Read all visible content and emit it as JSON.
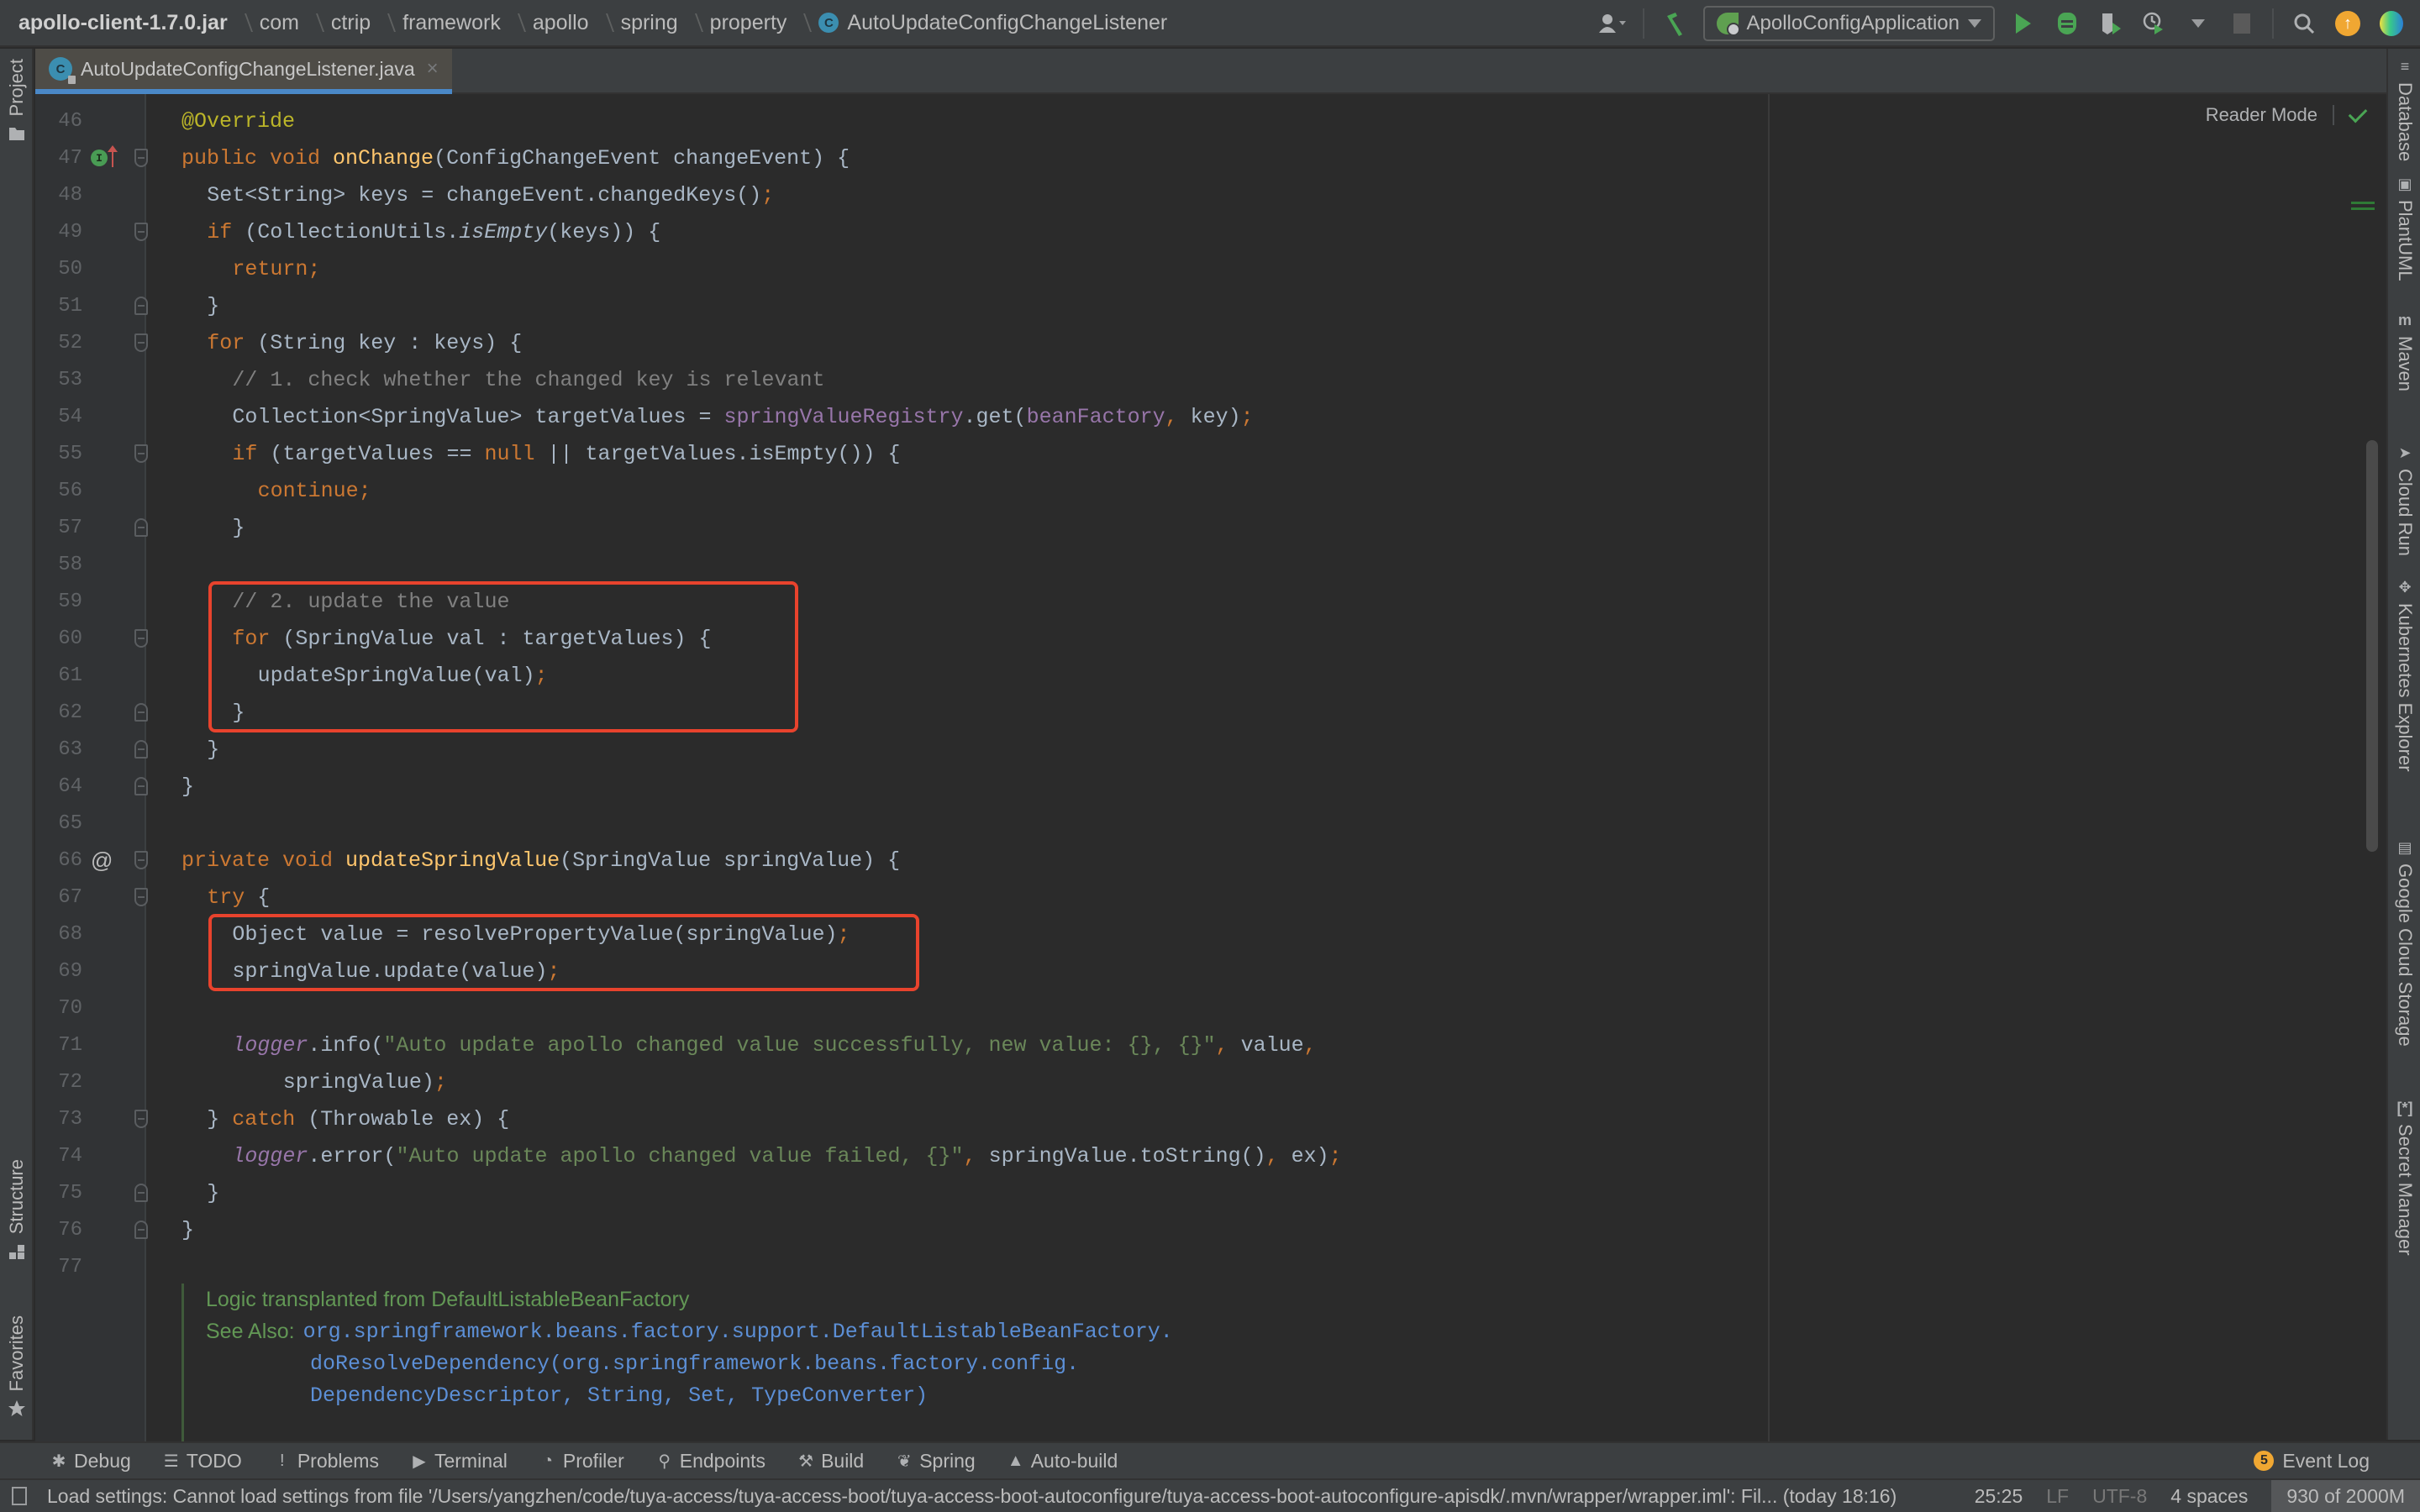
{
  "breadcrumbs": [
    {
      "label": "apollo-client-1.7.0.jar"
    },
    {
      "label": "com"
    },
    {
      "label": "ctrip"
    },
    {
      "label": "framework"
    },
    {
      "label": "apollo"
    },
    {
      "label": "spring"
    },
    {
      "label": "property"
    },
    {
      "label": "AutoUpdateConfigChangeListener",
      "icon": "class-icon"
    }
  ],
  "toolbar": {
    "run_config": "ApolloConfigApplication",
    "icons": [
      "user-icon",
      "build-hammer-icon",
      "run-icon",
      "debug-icon",
      "coverage-icon",
      "profile-icon",
      "stop-icon",
      "search-icon",
      "update-icon",
      "toolbox-icon"
    ],
    "class_icon_letter": "C"
  },
  "tab": {
    "label": "AutoUpdateConfigChangeListener.java",
    "close": "×"
  },
  "left_strip": {
    "top": [
      {
        "label": "Project"
      }
    ],
    "bottom": [
      {
        "label": "Structure"
      },
      {
        "label": "Favorites"
      }
    ]
  },
  "right_strip": [
    {
      "label": "Database",
      "icon": "database-icon",
      "glyph": "≡"
    },
    {
      "label": "PlantUML",
      "icon": "plantuml-icon",
      "glyph": "▣"
    },
    {
      "label": "Maven",
      "icon": "maven-icon",
      "glyph": "m"
    },
    {
      "label": "Cloud Run",
      "icon": "cloud-run-icon",
      "glyph": "➤"
    },
    {
      "label": "Kubernetes Explorer",
      "icon": "kubernetes-icon",
      "glyph": "✥"
    },
    {
      "label": "Google Cloud Storage",
      "icon": "cloud-storage-icon",
      "glyph": "▤"
    },
    {
      "label": "Secret Manager",
      "icon": "secret-manager-icon",
      "glyph": "[*]"
    }
  ],
  "editor": {
    "reader_mode": "Reader Mode",
    "lines": [
      {
        "n": "46",
        "tokens": [
          {
            "t": "@Override",
            "c": "ann"
          }
        ],
        "indent": 1
      },
      {
        "n": "47",
        "tokens": [
          {
            "t": "public void ",
            "c": "kw"
          },
          {
            "t": "onChange",
            "c": "fn"
          },
          {
            "t": "(ConfigChangeEvent changeEvent) {",
            "c": ""
          }
        ],
        "indent": 1,
        "marker": "implements",
        "fold": "open"
      },
      {
        "n": "48",
        "tokens": [
          {
            "t": "Set<String> keys = changeEvent.changedKeys()",
            "c": ""
          },
          {
            "t": ";",
            "c": "kw"
          }
        ],
        "indent": 2
      },
      {
        "n": "49",
        "tokens": [
          {
            "t": "if ",
            "c": "kw"
          },
          {
            "t": "(CollectionUtils.",
            "c": ""
          },
          {
            "t": "isEmpty",
            "c": "it"
          },
          {
            "t": "(keys)) {",
            "c": ""
          }
        ],
        "indent": 2,
        "fold": "open"
      },
      {
        "n": "50",
        "tokens": [
          {
            "t": "return;",
            "c": "kw"
          }
        ],
        "indent": 3
      },
      {
        "n": "51",
        "tokens": [
          {
            "t": "}",
            "c": ""
          }
        ],
        "indent": 2,
        "fold": "close"
      },
      {
        "n": "52",
        "tokens": [
          {
            "t": "for ",
            "c": "kw"
          },
          {
            "t": "(String key : keys) {",
            "c": ""
          }
        ],
        "indent": 2,
        "fold": "open"
      },
      {
        "n": "53",
        "tokens": [
          {
            "t": "// 1. check whether the changed key is relevant",
            "c": "cm"
          }
        ],
        "indent": 3
      },
      {
        "n": "54",
        "tokens": [
          {
            "t": "Collection<SpringValue> targetValues = ",
            "c": ""
          },
          {
            "t": "springValueRegistry",
            "c": "fld"
          },
          {
            "t": ".get(",
            "c": ""
          },
          {
            "t": "beanFactory",
            "c": "fld"
          },
          {
            "t": ", ",
            "c": "kw"
          },
          {
            "t": "key)",
            "c": ""
          },
          {
            "t": ";",
            "c": "kw"
          }
        ],
        "indent": 3
      },
      {
        "n": "55",
        "tokens": [
          {
            "t": "if ",
            "c": "kw"
          },
          {
            "t": "(targetValues == ",
            "c": ""
          },
          {
            "t": "null ",
            "c": "kw"
          },
          {
            "t": "|| targetValues.isEmpty()) {",
            "c": ""
          }
        ],
        "indent": 3,
        "fold": "open"
      },
      {
        "n": "56",
        "tokens": [
          {
            "t": "continue;",
            "c": "kw"
          }
        ],
        "indent": 4
      },
      {
        "n": "57",
        "tokens": [
          {
            "t": "}",
            "c": ""
          }
        ],
        "indent": 3,
        "fold": "close"
      },
      {
        "n": "58",
        "tokens": [],
        "indent": 3
      },
      {
        "n": "59",
        "tokens": [
          {
            "t": "// 2. update the value",
            "c": "cm"
          }
        ],
        "indent": 3
      },
      {
        "n": "60",
        "tokens": [
          {
            "t": "for ",
            "c": "kw"
          },
          {
            "t": "(SpringValue val : targetValues) {",
            "c": ""
          }
        ],
        "indent": 3,
        "fold": "open"
      },
      {
        "n": "61",
        "tokens": [
          {
            "t": "updateSpringValue(val)",
            "c": ""
          },
          {
            "t": ";",
            "c": "kw"
          }
        ],
        "indent": 4
      },
      {
        "n": "62",
        "tokens": [
          {
            "t": "}",
            "c": ""
          }
        ],
        "indent": 3,
        "fold": "close"
      },
      {
        "n": "63",
        "tokens": [
          {
            "t": "}",
            "c": ""
          }
        ],
        "indent": 2,
        "fold": "close"
      },
      {
        "n": "64",
        "tokens": [
          {
            "t": "}",
            "c": ""
          }
        ],
        "indent": 1,
        "fold": "close"
      },
      {
        "n": "65",
        "tokens": [],
        "indent": 1
      },
      {
        "n": "66",
        "tokens": [
          {
            "t": "private void ",
            "c": "kw"
          },
          {
            "t": "updateSpringValue",
            "c": "fn"
          },
          {
            "t": "(SpringValue springValue) {",
            "c": ""
          }
        ],
        "indent": 1,
        "marker": "at",
        "fold": "open"
      },
      {
        "n": "67",
        "tokens": [
          {
            "t": "try ",
            "c": "kw"
          },
          {
            "t": "{",
            "c": ""
          }
        ],
        "indent": 2,
        "fold": "open"
      },
      {
        "n": "68",
        "tokens": [
          {
            "t": "Object value = resolvePropertyValue(springValue)",
            "c": ""
          },
          {
            "t": ";",
            "c": "kw"
          }
        ],
        "indent": 3
      },
      {
        "n": "69",
        "tokens": [
          {
            "t": "springValue.update(value)",
            "c": ""
          },
          {
            "t": ";",
            "c": "kw"
          }
        ],
        "indent": 3
      },
      {
        "n": "70",
        "tokens": [],
        "indent": 3
      },
      {
        "n": "71",
        "tokens": [
          {
            "t": "logger",
            "c": "fld it"
          },
          {
            "t": ".info(",
            "c": ""
          },
          {
            "t": "\"Auto update apollo changed value successfully, new value: {}, {}\"",
            "c": "str"
          },
          {
            "t": ", ",
            "c": "kw"
          },
          {
            "t": "value",
            "c": ""
          },
          {
            "t": ",",
            "c": "kw"
          }
        ],
        "indent": 3
      },
      {
        "n": "72",
        "tokens": [
          {
            "t": "springValue)",
            "c": ""
          },
          {
            "t": ";",
            "c": "kw"
          }
        ],
        "indent": 5
      },
      {
        "n": "73",
        "tokens": [
          {
            "t": "} ",
            "c": ""
          },
          {
            "t": "catch ",
            "c": "kw"
          },
          {
            "t": "(Throwable ex) {",
            "c": ""
          }
        ],
        "indent": 2,
        "fold": "open"
      },
      {
        "n": "74",
        "tokens": [
          {
            "t": "logger",
            "c": "fld it"
          },
          {
            "t": ".error(",
            "c": ""
          },
          {
            "t": "\"Auto update apollo changed value failed, {}\"",
            "c": "str"
          },
          {
            "t": ", ",
            "c": "kw"
          },
          {
            "t": "springValue.toString()",
            "c": ""
          },
          {
            "t": ", ",
            "c": "kw"
          },
          {
            "t": "ex)",
            "c": ""
          },
          {
            "t": ";",
            "c": "kw"
          }
        ],
        "indent": 3
      },
      {
        "n": "75",
        "tokens": [
          {
            "t": "}",
            "c": ""
          }
        ],
        "indent": 2,
        "fold": "close"
      },
      {
        "n": "76",
        "tokens": [
          {
            "t": "}",
            "c": ""
          }
        ],
        "indent": 1,
        "fold": "close"
      },
      {
        "n": "77",
        "tokens": [],
        "indent": 1
      }
    ],
    "highlight_boxes": [
      {
        "from_line": "59",
        "to_line": "62",
        "color": "#e8432d"
      },
      {
        "from_line": "68",
        "to_line": "69",
        "color": "#e8432d"
      }
    ],
    "doc": {
      "title": "Logic transplanted from DefaultListableBeanFactory",
      "see_also_label": "See Also:",
      "links": [
        "org.springframework.beans.factory.support.DefaultListableBeanFactory.",
        "doResolveDependency(org.springframework.beans.factory.config.",
        "DependencyDescriptor, String, Set, TypeConverter)"
      ]
    }
  },
  "bottom_tools": [
    {
      "label": "Debug",
      "icon": "debug-icon",
      "glyph": "✱"
    },
    {
      "label": "TODO",
      "icon": "todo-icon",
      "glyph": "☰"
    },
    {
      "label": "Problems",
      "icon": "problems-icon",
      "glyph": "!"
    },
    {
      "label": "Terminal",
      "icon": "terminal-icon",
      "glyph": "▶"
    },
    {
      "label": "Profiler",
      "icon": "profiler-icon",
      "glyph": "◔"
    },
    {
      "label": "Endpoints",
      "icon": "endpoints-icon",
      "glyph": "⚲"
    },
    {
      "label": "Build",
      "icon": "build-icon",
      "glyph": "⚒"
    },
    {
      "label": "Spring",
      "icon": "spring-icon",
      "glyph": "❦"
    },
    {
      "label": "Auto-build",
      "icon": "warning-icon",
      "glyph": "▲"
    }
  ],
  "event_log": {
    "label": "Event Log",
    "count": "5"
  },
  "status": {
    "message": "Load settings: Cannot load settings from file '/Users/yangzhen/code/tuya-access/tuya-access-boot/tuya-access-boot-autoconfigure/tuya-access-boot-autoconfigure-apisdk/.mvn/wrapper/wrapper.iml': Fil... (today 18:16)",
    "position": "25:25",
    "line_ending": "LF",
    "encoding": "UTF-8",
    "indent": "4 spaces",
    "memory": "930 of 2000M"
  },
  "colors": {
    "keyword": "#cc7832",
    "function": "#ffc66d",
    "annotation": "#bbb529",
    "comment": "#808080",
    "string": "#6a8759",
    "field": "#9876aa",
    "highlight": "#e8432d",
    "tab_underline": "#4a88c7"
  }
}
